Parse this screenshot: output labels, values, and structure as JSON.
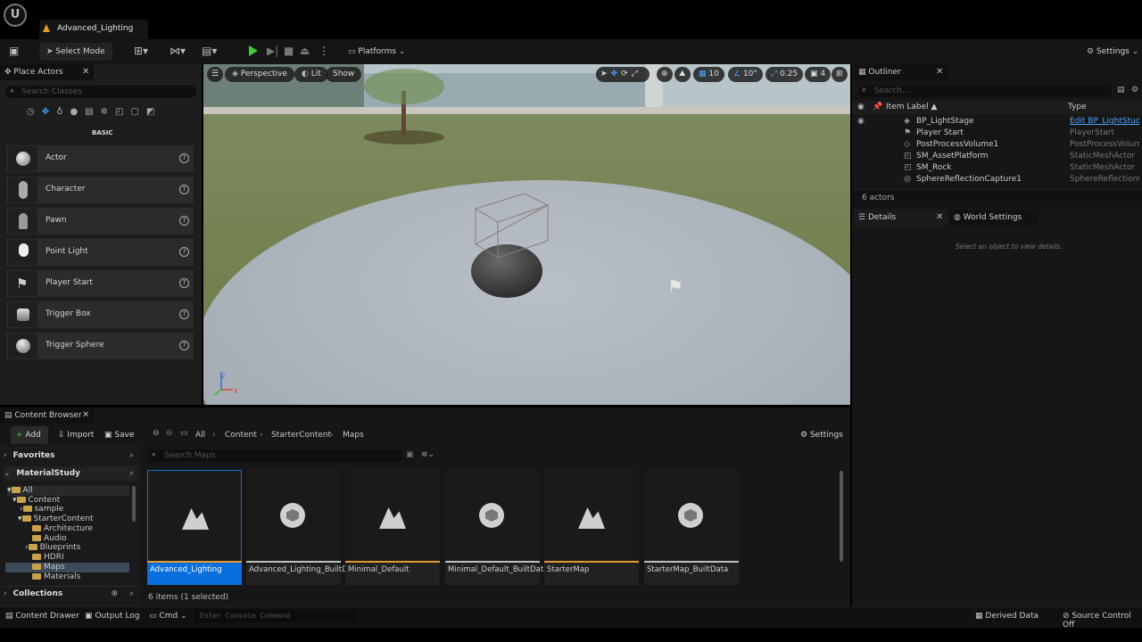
{
  "app": {
    "doc_tab": "Advanced_Lighting",
    "logo_glyph": "U"
  },
  "toolbar": {
    "select_mode": "Select Mode",
    "platforms": "Platforms",
    "settings": "Settings"
  },
  "place_actors": {
    "tab_label": "Place Actors",
    "search_placeholder": "Search Classes",
    "category": "BASIC",
    "items": [
      {
        "label": "Actor",
        "icon": "actor-sphere-icon"
      },
      {
        "label": "Character",
        "icon": "character-icon"
      },
      {
        "label": "Pawn",
        "icon": "pawn-icon"
      },
      {
        "label": "Point Light",
        "icon": "point-light-icon"
      },
      {
        "label": "Player Start",
        "icon": "player-start-icon"
      },
      {
        "label": "Trigger Box",
        "icon": "trigger-box-icon"
      },
      {
        "label": "Trigger Sphere",
        "icon": "trigger-sphere-icon"
      }
    ]
  },
  "viewport": {
    "perspective": "Perspective",
    "lit": "Lit",
    "show": "Show",
    "grid_snap": "10",
    "rotation_snap": "10°",
    "scale_snap": "0.25",
    "camera_speed": "4"
  },
  "outliner": {
    "tab_label": "Outliner",
    "search_placeholder": "Search...",
    "col_label": "Item Label ▲",
    "col_type": "Type",
    "rows": [
      {
        "name": "BP_LightStage",
        "type": "Edit BP_LightStudio",
        "link": true
      },
      {
        "name": "Player Start",
        "type": "PlayerStart"
      },
      {
        "name": "PostProcessVolume1",
        "type": "PostProcessVolume"
      },
      {
        "name": "SM_AssetPlatform",
        "type": "StaticMeshActor"
      },
      {
        "name": "SM_Rock",
        "type": "StaticMeshActor"
      },
      {
        "name": "SphereReflectionCapture1",
        "type": "SphereReflectionCapture"
      }
    ],
    "count": "6 actors"
  },
  "details": {
    "tab_label": "Details",
    "world_settings_tab": "World Settings",
    "empty_message": "Select an object to view details."
  },
  "content_browser": {
    "tab_label": "Content Browser",
    "add": "Add",
    "import": "Import",
    "save_all": "Save All",
    "breadcrumbs": [
      "All",
      "Content",
      "StarterContent",
      "Maps"
    ],
    "settings": "Settings",
    "favorites": "Favorites",
    "project": "MaterialStudy",
    "collections": "Collections",
    "search_placeholder": "Search Maps",
    "tree": [
      "All",
      "Content",
      "sample",
      "StarterContent",
      "Architecture",
      "Audio",
      "Blueprints",
      "HDRI",
      "Maps",
      "Materials"
    ],
    "assets": [
      {
        "label": "Advanced_Lighting",
        "kind": "map",
        "selected": true
      },
      {
        "label": "Advanced_Lighting_BuiltData",
        "kind": "builtdata"
      },
      {
        "label": "Minimal_Default",
        "kind": "map"
      },
      {
        "label": "Minimal_Default_BuiltData",
        "kind": "builtdata"
      },
      {
        "label": "StarterMap",
        "kind": "map"
      },
      {
        "label": "StarterMap_BuiltData",
        "kind": "builtdata"
      }
    ],
    "status": "6 items (1 selected)"
  },
  "statusbar": {
    "content_drawer": "Content Drawer",
    "output_log": "Output Log",
    "cmd": "Cmd",
    "console_placeholder": "Enter Console Command",
    "derived_data": "Derived Data",
    "source_control": "Source Control Off"
  },
  "colors": {
    "accent": "#0070e0",
    "selected_asset": "#0a6fdc",
    "map_bar": "#e39a2f",
    "builtdata_bar": "#bfbfbf",
    "play": "#3ecb3e"
  }
}
